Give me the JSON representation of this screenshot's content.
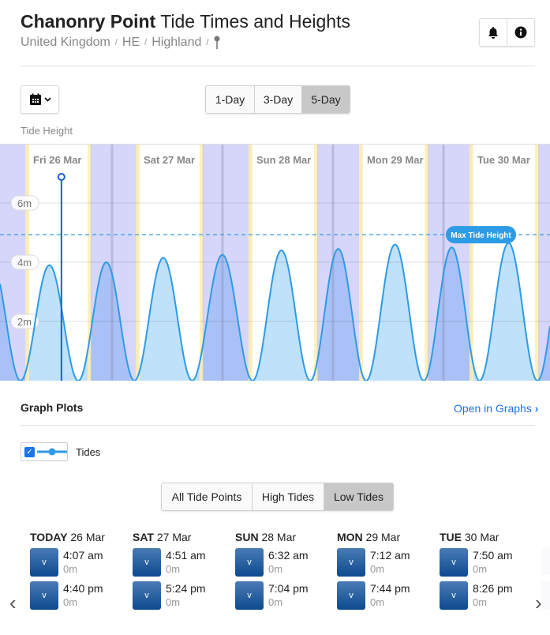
{
  "header": {
    "title_bold": "Chanonry Point",
    "title_rest": " Tide Times and Heights",
    "breadcrumb": [
      "United Kingdom",
      "HE",
      "Highland"
    ],
    "breadcrumb_sep": "/",
    "pin_icon": "map-pin-icon",
    "buttons": [
      {
        "icon": "bell-icon"
      },
      {
        "icon": "info-icon"
      }
    ]
  },
  "controls": {
    "calendar_icon": "calendar-icon",
    "range_tabs": [
      {
        "label": "1-Day"
      },
      {
        "label": "3-Day"
      },
      {
        "label": "5-Day",
        "selected": true
      }
    ]
  },
  "chart_label": "Tide Height",
  "chart_data": {
    "type": "area",
    "ylabel": "Tide Height",
    "y_unit": "m",
    "y_ticks": [
      {
        "value": 2,
        "label": "2m"
      },
      {
        "value": 4,
        "label": "4m"
      },
      {
        "value": 6,
        "label": "6m"
      }
    ],
    "ylim": [
      0,
      8
    ],
    "day_labels": [
      {
        "dow": "Fri",
        "date": "26 Mar"
      },
      {
        "dow": "Sat",
        "date": "27 Mar"
      },
      {
        "dow": "Sun",
        "date": "28 Mar"
      },
      {
        "dow": "Mon",
        "date": "29 Mar"
      },
      {
        "dow": "Tue",
        "date": "30 Mar"
      }
    ],
    "low_tides": [
      {
        "day": 0,
        "time": "04:07",
        "height": 0
      },
      {
        "day": 0,
        "time": "16:40",
        "height": 0
      },
      {
        "day": 1,
        "time": "04:51",
        "height": 0
      },
      {
        "day": 1,
        "time": "17:24",
        "height": 0
      },
      {
        "day": 2,
        "time": "06:32",
        "height": 0
      },
      {
        "day": 2,
        "time": "19:04",
        "height": 0
      },
      {
        "day": 3,
        "time": "07:12",
        "height": 0
      },
      {
        "day": 3,
        "time": "19:44",
        "height": 0
      },
      {
        "day": 4,
        "time": "07:50",
        "height": 0
      },
      {
        "day": 4,
        "time": "20:26",
        "height": 0
      }
    ],
    "high_tide_heights_est": [
      4.0,
      3.9,
      4.0,
      4.15,
      4.25,
      4.4,
      4.45,
      4.6,
      4.5,
      4.65,
      4.6
    ],
    "daylight": [
      {
        "day": 0,
        "from": "05:40",
        "to": "19:00"
      },
      {
        "day": 1,
        "from": "05:40",
        "to": "19:20"
      },
      {
        "day": 2,
        "from": "06:10",
        "to": "20:15"
      },
      {
        "day": 3,
        "from": "06:10",
        "to": "20:15"
      },
      {
        "day": 4,
        "from": "06:10",
        "to": "20:15"
      }
    ],
    "current_time": {
      "day": 0,
      "time": "13:00"
    },
    "max_tide": {
      "label": "Max Tide Height",
      "value": 4.93
    },
    "colors": {
      "line": "#2e9be6",
      "fill": "#bfe1f9",
      "night": "#7878f0",
      "twilight": "#fdeeb0",
      "now": "#1a5fd0"
    },
    "grid": true
  },
  "plots": {
    "title": "Graph Plots",
    "open_link": "Open in Graphs",
    "chevron": "›",
    "items": [
      {
        "label": "Tides",
        "checked": true
      }
    ]
  },
  "tide_filter": [
    {
      "label": "All Tide Points"
    },
    {
      "label": "High Tides"
    },
    {
      "label": "Low Tides",
      "selected": true
    }
  ],
  "tide_days": [
    {
      "dow": "TODAY",
      "date": "26 Mar",
      "tides": [
        {
          "time": "4:07 am",
          "height": "0m"
        },
        {
          "time": "4:40 pm",
          "height": "0m"
        }
      ]
    },
    {
      "dow": "SAT",
      "date": "27 Mar",
      "tides": [
        {
          "time": "4:51 am",
          "height": "0m"
        },
        {
          "time": "5:24 pm",
          "height": "0m"
        }
      ]
    },
    {
      "dow": "SUN",
      "date": "28 Mar",
      "tides": [
        {
          "time": "6:32 am",
          "height": "0m"
        },
        {
          "time": "7:04 pm",
          "height": "0m"
        }
      ]
    },
    {
      "dow": "MON",
      "date": "29 Mar",
      "tides": [
        {
          "time": "7:12 am",
          "height": "0m"
        },
        {
          "time": "7:44 pm",
          "height": "0m"
        }
      ]
    },
    {
      "dow": "TUE",
      "date": "30 Mar",
      "tides": [
        {
          "time": "7:50 am",
          "height": "0m"
        },
        {
          "time": "8:26 pm",
          "height": "0m"
        }
      ]
    }
  ],
  "low_tide_arrow": "v",
  "nav": {
    "prev": "‹",
    "next": "›"
  }
}
